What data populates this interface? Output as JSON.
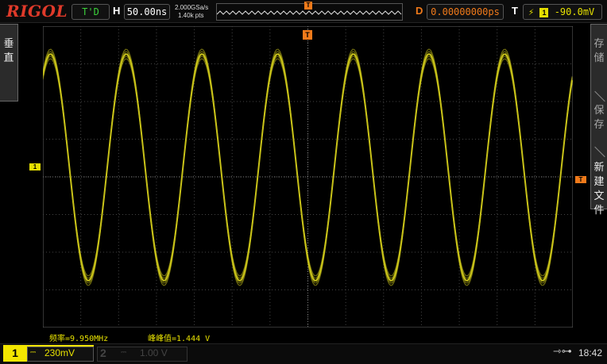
{
  "brand": "RIGOL",
  "top": {
    "run_state": "T'D",
    "horizontal_label": "H",
    "timebase": "50.00ns",
    "sample_rate": "2.000GSa/s",
    "memory_depth": "1.40k pts",
    "delay_label": "D",
    "delay": "0.00000000ps",
    "trigger_label": "T",
    "trigger_channel": "1",
    "trigger_level": "-90.0mV"
  },
  "left_menu": {
    "label": "垂直"
  },
  "right_menu": {
    "items": [
      {
        "label": "存储"
      },
      {
        "label": "保存"
      },
      {
        "label": "新建文件"
      }
    ]
  },
  "markers": {
    "channel1": "1",
    "trigger_level": "T",
    "trigger_position": "T"
  },
  "measurements": {
    "frequency": "频率=9.950MHz",
    "peak_to_peak": "峰峰值=1.444 V"
  },
  "channels": [
    {
      "number": "1",
      "coupling": "⎓",
      "scale": "230mV",
      "color": "#f3e600"
    },
    {
      "number": "2",
      "coupling": "⎓",
      "scale": "1.00 V",
      "color": "#444444"
    }
  ],
  "status": {
    "usb_icon": "usb-icon",
    "time": "18:42"
  },
  "waveform": {
    "channel": "1",
    "color": "#c8c21a",
    "cycles_visible": 7,
    "peak_to_peak_V": 1.444,
    "frequency_MHz": 9.95
  }
}
